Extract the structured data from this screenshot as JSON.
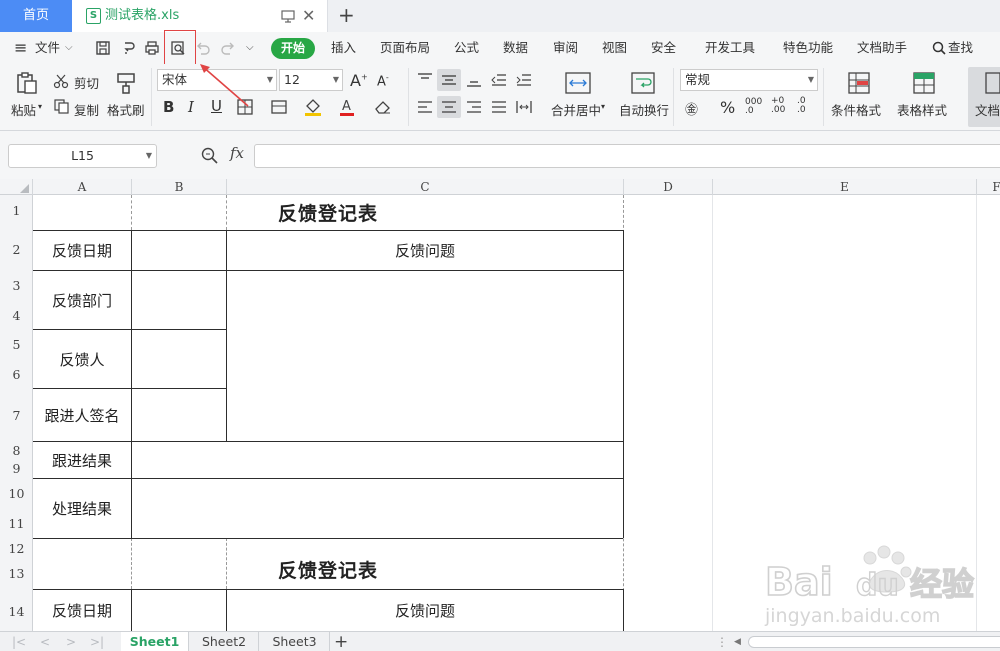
{
  "tabs": {
    "home": "首页",
    "document": "测试表格.xls"
  },
  "menu": {
    "file": "文件",
    "items": [
      "开始",
      "插入",
      "页面布局",
      "公式",
      "数据",
      "审阅",
      "视图",
      "安全",
      "开发工具",
      "特色功能",
      "文档助手",
      "查找"
    ]
  },
  "ribbon": {
    "paste": "粘贴",
    "cut": "剪切",
    "copy": "复制",
    "format_painter": "格式刷",
    "font_name": "宋体",
    "font_size": "12",
    "merge_center": "合并居中",
    "wrap_text": "自动换行",
    "number_format": "常规",
    "conditional_format": "条件格式",
    "table_style": "表格样式",
    "doc_assist": "文档助"
  },
  "formula_bar": {
    "name_box": "L15",
    "fx": "fx",
    "value": ""
  },
  "columns": [
    "A",
    "B",
    "C",
    "D",
    "E",
    "F"
  ],
  "rows": [
    "1",
    "2",
    "3",
    "4",
    "5",
    "6",
    "7",
    "8",
    "9",
    "10",
    "11",
    "12",
    "13",
    "14"
  ],
  "cells": {
    "title1": "反馈登记表",
    "r2a": "反馈日期",
    "r2c": "反馈问题",
    "r34a": "反馈部门",
    "r56a": "反馈人",
    "r7a": "跟进人签名",
    "r89a": "跟进结果",
    "r1011a": "处理结果",
    "title2": "反馈登记表",
    "r14a": "反馈日期",
    "r14c": "反馈问题"
  },
  "sheets": [
    "Sheet1",
    "Sheet2",
    "Sheet3"
  ],
  "watermark": {
    "brand": "Baidu经验",
    "url": "jingyan.baidu.com"
  },
  "colors": {
    "accent_blue": "#4c8cf5",
    "green": "#2aa366",
    "start_green": "#28a745",
    "callout_red": "#e04444"
  }
}
